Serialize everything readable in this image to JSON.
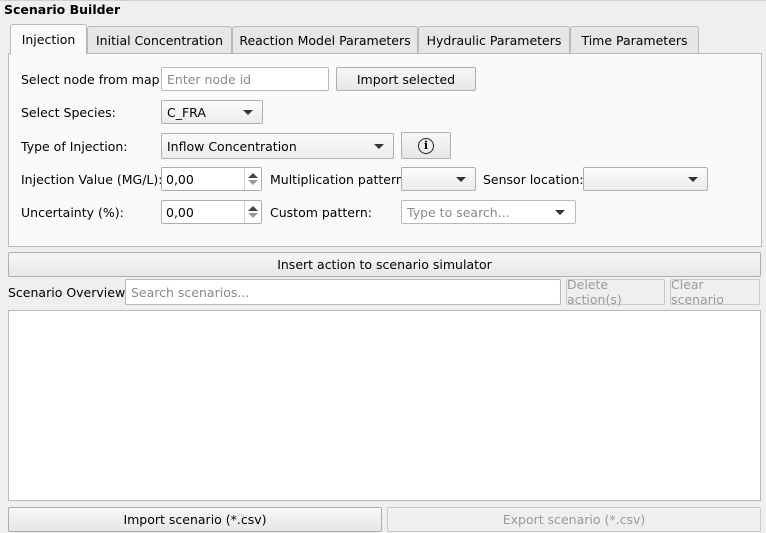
{
  "window": {
    "title": "Scenario Builder"
  },
  "tabs": [
    {
      "label": "Injection",
      "active": true
    },
    {
      "label": "Initial Concentration",
      "active": false
    },
    {
      "label": "Reaction Model Parameters",
      "active": false
    },
    {
      "label": "Hydraulic Parameters",
      "active": false
    },
    {
      "label": "Time Parameters",
      "active": false
    }
  ],
  "injection": {
    "node_label": "Select node from map:",
    "node_placeholder": "Enter node id",
    "import_selected": "Import selected",
    "species_label": "Select Species:",
    "species_value": "C_FRA",
    "type_label": "Type of Injection:",
    "type_value": "Inflow Concentration",
    "value_label": "Injection Value (MG/L):",
    "value": "0,00",
    "mult_label": "Multiplication pattern:",
    "sensor_label": "Sensor location:",
    "uncert_label": "Uncertainty (%):",
    "uncert_value": "0,00",
    "custom_label": "Custom pattern:",
    "custom_placeholder": "Type to search..."
  },
  "insert_action": "Insert action to scenario simulator",
  "overview": {
    "label": "Scenario Overview:",
    "search_placeholder": "Search scenarios...",
    "delete_label": "Delete action(s)",
    "clear_label": "Clear scenario"
  },
  "footer": {
    "import_label": "Import scenario (*.csv)",
    "export_label": "Export scenario (*.csv)"
  },
  "icons": {
    "info": "info-icon"
  }
}
